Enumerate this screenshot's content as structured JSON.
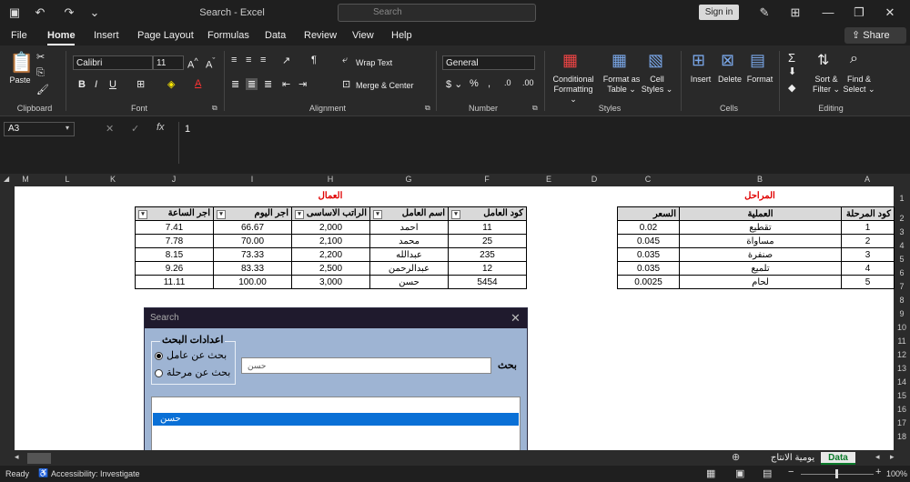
{
  "window": {
    "title": "Search  -  Excel",
    "search_placeholder": "Search",
    "signin": "Sign in"
  },
  "menu": [
    "File",
    "Home",
    "Insert",
    "Page Layout",
    "Formulas",
    "Data",
    "Review",
    "View",
    "Help"
  ],
  "share": "Share",
  "ribbon": {
    "paste": "Paste",
    "font_name": "Calibri",
    "font_size": "11",
    "wrap_text": "Wrap Text",
    "merge_center": "Merge & Center",
    "number_format": "General",
    "conditional_1": "Conditional",
    "conditional_2": "Formatting",
    "format_as_1": "Format as",
    "format_as_2": "Table",
    "cell_1": "Cell",
    "cell_2": "Styles",
    "insert": "Insert",
    "delete": "Delete",
    "format": "Format",
    "sort_1": "Sort &",
    "sort_2": "Filter",
    "find_1": "Find &",
    "find_2": "Select",
    "groups": {
      "clipboard": "Clipboard",
      "font": "Font",
      "alignment": "Alignment",
      "number": "Number",
      "styles": "Styles",
      "cells": "Cells",
      "editing": "Editing"
    }
  },
  "formula_bar": {
    "name_box": "A3",
    "fx": "fx",
    "value": "1"
  },
  "columns": [
    "M",
    "L",
    "K",
    "J",
    "I",
    "H",
    "G",
    "F",
    "E",
    "D",
    "C",
    "B",
    "A"
  ],
  "rows": [
    "1",
    "2",
    "3",
    "4",
    "5",
    "6",
    "7",
    "8",
    "9",
    "10",
    "11",
    "12",
    "13",
    "14",
    "15",
    "16",
    "17",
    "18"
  ],
  "workers": {
    "title": "العمال",
    "headers": [
      "اجر الساعة",
      "اجر اليوم",
      "الراتب الاساسى",
      "اسم العامل",
      "كود العامل"
    ],
    "rows": [
      [
        "7.41",
        "66.67",
        "2,000",
        "احمد",
        "11"
      ],
      [
        "7.78",
        "70.00",
        "2,100",
        "محمد",
        "25"
      ],
      [
        "8.15",
        "73.33",
        "2,200",
        "عبدالله",
        "235"
      ],
      [
        "9.26",
        "83.33",
        "2,500",
        "عبدالرحمن",
        "12"
      ],
      [
        "11.11",
        "100.00",
        "3,000",
        "حسن",
        "5454"
      ]
    ]
  },
  "stages": {
    "title": "المراحل",
    "headers": [
      "السعر",
      "العملية",
      "كود المرحلة"
    ],
    "rows": [
      [
        "0.02",
        "تقطيع",
        "1"
      ],
      [
        "0.045",
        "مساواة",
        "2"
      ],
      [
        "0.035",
        "صنفرة",
        "3"
      ],
      [
        "0.035",
        "تلميع",
        "4"
      ],
      [
        "0.0025",
        "لحام",
        "5"
      ]
    ]
  },
  "dialog": {
    "title": "Search",
    "group_title": "اعدادات البحث",
    "radio_worker": "بحث عن عامل",
    "radio_stage": "بحث عن مرحلة",
    "search_label": "بحث",
    "search_value": "حسن",
    "result_selected": "حسن"
  },
  "sheet_tabs": {
    "active": "Data",
    "other": "يومية الانتاج"
  },
  "status": {
    "ready": "Ready",
    "accessibility": "Accessibility: Investigate",
    "zoom": "100%"
  }
}
